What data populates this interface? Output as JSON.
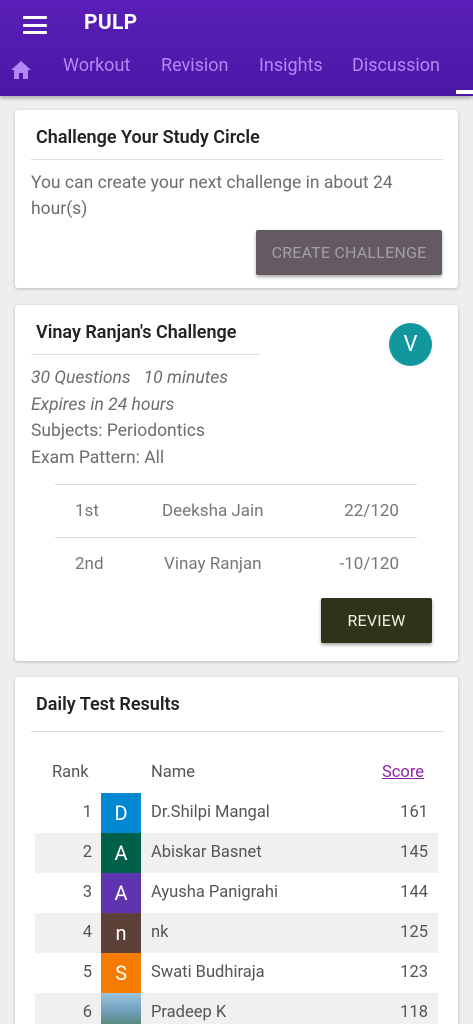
{
  "app": {
    "title": "PULP"
  },
  "tabs": [
    "Workout",
    "Revision",
    "Insights",
    "Discussion"
  ],
  "challenge_circle": {
    "title": "Challenge Your Study Circle",
    "message": "You can create your next challenge in about 24 hour(s)",
    "button": "CREATE CHALLENGE"
  },
  "user_challenge": {
    "title": "Vinay Ranjan's Challenge",
    "avatar_letter": "V",
    "avatar_color": "#12979f",
    "questions": "30 Questions",
    "minutes": "10 minutes",
    "expires": "Expires in 24 hours",
    "subjects": "Subjects: Periodontics",
    "pattern": "Exam Pattern: All",
    "leaderboard": [
      {
        "place": "1st",
        "name": "Deeksha Jain",
        "score": "22/120"
      },
      {
        "place": "2nd",
        "name": "Vinay Ranjan",
        "score": "-10/120"
      }
    ],
    "button": "REVIEW"
  },
  "daily_results": {
    "title": "Daily Test Results",
    "headers": {
      "rank": "Rank",
      "name": "Name",
      "score": "Score"
    },
    "rows": [
      {
        "rank": "1",
        "letter": "D",
        "color": "#0288d1",
        "name": "Dr.Shilpi Mangal",
        "score": "161"
      },
      {
        "rank": "2",
        "letter": "A",
        "color": "#00614a",
        "name": "Abiskar Basnet",
        "score": "145"
      },
      {
        "rank": "3",
        "letter": "A",
        "color": "#5e35b1",
        "name": "Ayusha Panigrahi",
        "score": "144"
      },
      {
        "rank": "4",
        "letter": "n",
        "color": "#5d4037",
        "name": "nk",
        "score": "125"
      },
      {
        "rank": "5",
        "letter": "S",
        "color": "#f57c00",
        "name": "Swati Budhiraja",
        "score": "123"
      },
      {
        "rank": "6",
        "letter": "",
        "color": "#7aa8c4",
        "name": "Pradeep K",
        "score": "118"
      }
    ]
  }
}
